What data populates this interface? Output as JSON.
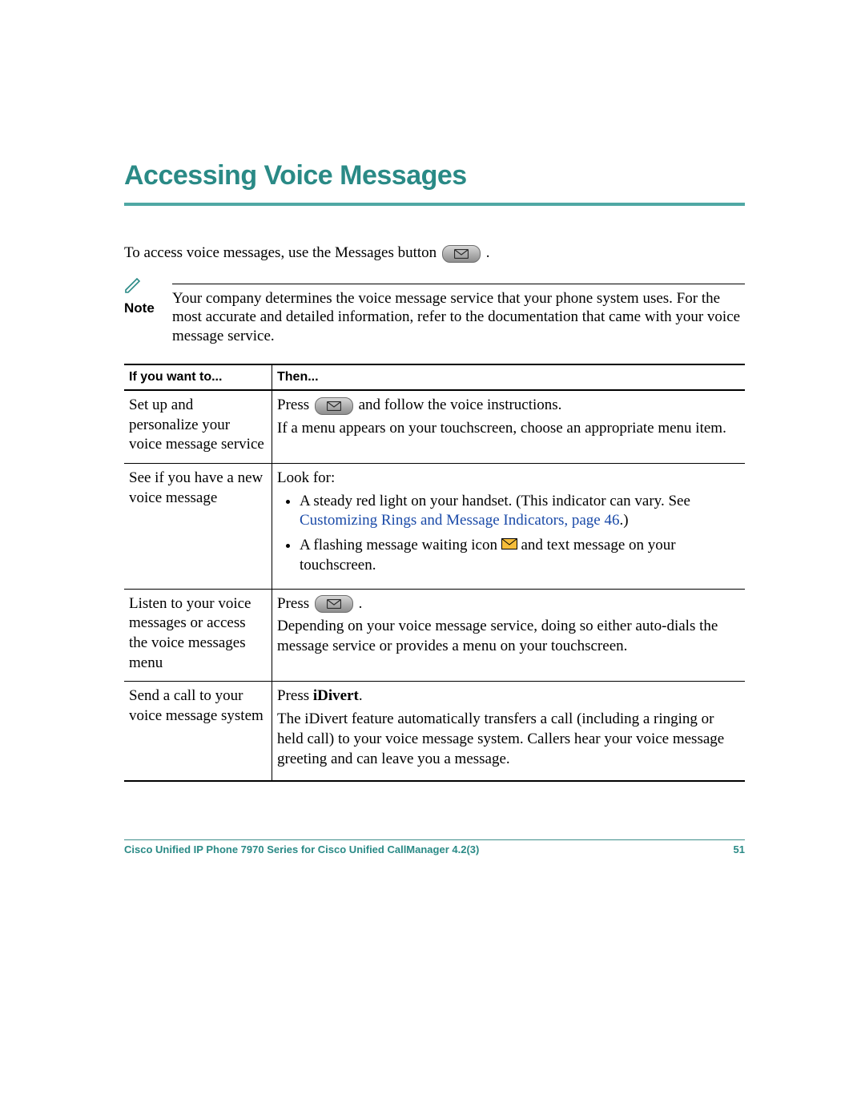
{
  "colors": {
    "accent": "#2a8a86",
    "link": "#1a4aa8"
  },
  "title": "Accessing Voice Messages",
  "intro_before": "To access voice messages, use the Messages button ",
  "intro_after": ".",
  "note": {
    "label": "Note",
    "text": "Your company determines the voice message service that your phone system uses. For the most accurate and detailed information, refer to the documentation that came with your voice message service."
  },
  "table": {
    "headers": {
      "if": "If you want to...",
      "then": "Then..."
    },
    "rows": {
      "r1": {
        "if": "Set up and personalize your voice message service",
        "then_press_before": "Press ",
        "then_press_after": " and follow the voice instructions.",
        "then_line2": "If a menu appears on your touchscreen, choose an appropriate menu item."
      },
      "r2": {
        "if": "See if you have a new voice message",
        "lookfor": "Look for:",
        "bullet1": "A steady red light on your handset. (This indicator can vary. See ",
        "bullet1_link": "Customizing Rings and Message Indicators, page 46",
        "bullet1_after": ".)",
        "bullet2_before": "A flashing message waiting icon ",
        "bullet2_after": " and text message on your touchscreen."
      },
      "r3": {
        "if": "Listen to your voice messages or access the voice messages menu",
        "press_before": "Press ",
        "press_after": ".",
        "line2": "Depending on your voice message service, doing so either auto-dials the message service or provides a menu on your touchscreen."
      },
      "r4": {
        "if": "Send a call to your voice message system",
        "press_before": "Press ",
        "idivert": "iDivert",
        "press_after": ".",
        "line2": "The iDivert feature automatically transfers a call (including a ringing or held call) to your voice message system. Callers hear your voice message greeting and can leave you a message."
      }
    }
  },
  "footer": {
    "doc": "Cisco Unified IP Phone 7970 Series for Cisco Unified CallManager 4.2(3)",
    "page": "51"
  }
}
